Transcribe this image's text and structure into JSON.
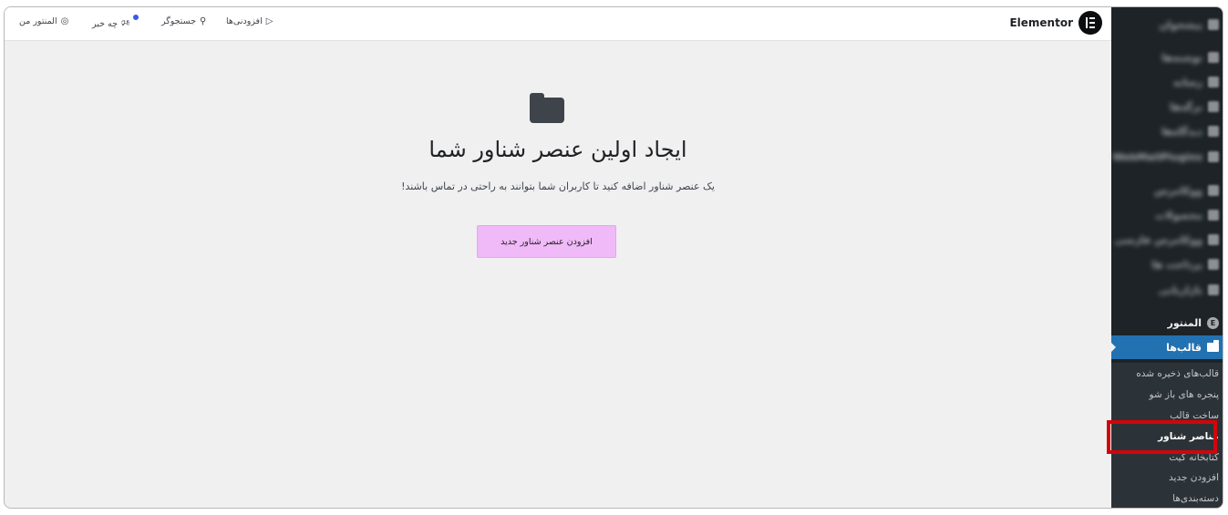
{
  "header": {
    "brand": "Elementor",
    "tools": [
      {
        "label": "المنتور من",
        "icon": "user-circle-icon"
      },
      {
        "label": "چه خبر",
        "icon": "megaphone-icon"
      },
      {
        "label": "جستجوگر",
        "icon": "search-icon"
      },
      {
        "label": "افزودنی‌ها",
        "icon": "rocket-icon"
      }
    ]
  },
  "empty_state": {
    "title": "ایجاد اولین عنصر شناور شما",
    "description": "یک عنصر شناور اضافه کنید تا کاربران شما بتوانند به راحتی در تماس باشند!",
    "button": "افزودن عنصر شناور جدید"
  },
  "sidebar": {
    "blurred_items": [
      "پیشخوان",
      "نوشته‌ها",
      "رسانه",
      "برگه‌ها",
      "دیدگاه‌ها",
      "WebMailPlugins",
      "ووکامرس",
      "محصولات",
      "ووکامرس فارسی",
      "پرداخت ها",
      "بازاریابی"
    ],
    "elementor": "المنتور",
    "current": "قالب‌ها",
    "submenu": [
      "قالب‌های ذخیره شده",
      "پنجره های باز شو",
      "ساخت قالب",
      "عناصر شناور",
      "کتابخانه کیت",
      "افزودن جدید",
      "دسته‌بندی‌ها"
    ],
    "active_submenu": "عناصر شناور"
  },
  "colors": {
    "sidebar_bg": "#1d2327",
    "current_bg": "#2271b1",
    "button_bg": "#f0b9f7",
    "highlight": "#d2050b"
  }
}
